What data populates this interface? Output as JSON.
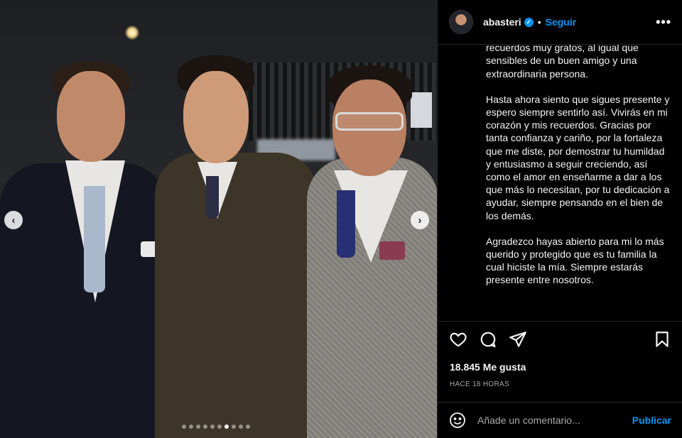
{
  "post": {
    "media": {
      "total_slides": 10,
      "active_slide": 7
    }
  },
  "header": {
    "username": "abasteri",
    "separator": "•",
    "follow_label": "Seguir",
    "more_label": "•••"
  },
  "caption": {
    "paragraphs": [
      "disfrutar tantas historias, momentos y recuerdos muy gratos, al igual que sensibles de un buen amigo y una extraordinaria persona.",
      "Hasta ahora siento que sigues presente y espero siempre sentirlo así. Vivirás en mi corazón y mis recuerdos. Gracias por tanta confianza y cariño, por la fortaleza que me diste, por demostrar tu humildad y entusiasmo a seguir creciendo, así como el amor en enseñarme a dar a los que más lo necesitan, por tu dedicación a ayudar, siempre pensando en el bien de los demás.",
      "Agradezco hayas abierto para mi lo más querido y protegido que es tu familia la cual hiciste la mía. Siempre estarás presente entre nosotros."
    ]
  },
  "stats": {
    "likes": "18.845 Me gusta",
    "time": "HACE 18 HORAS"
  },
  "comment": {
    "placeholder": "Añade un comentario...",
    "publish_label": "Publicar"
  },
  "icons": {
    "like": "heart-icon",
    "comment": "comment-icon",
    "share": "send-icon",
    "save": "bookmark-icon",
    "emoji": "emoji-icon",
    "prev": "chevron-left-icon",
    "next": "chevron-right-icon"
  },
  "colors": {
    "background": "#000000",
    "text": "#f5f5f5",
    "accent": "#0095f6",
    "muted": "#a8a8a8",
    "divider": "#262626"
  }
}
